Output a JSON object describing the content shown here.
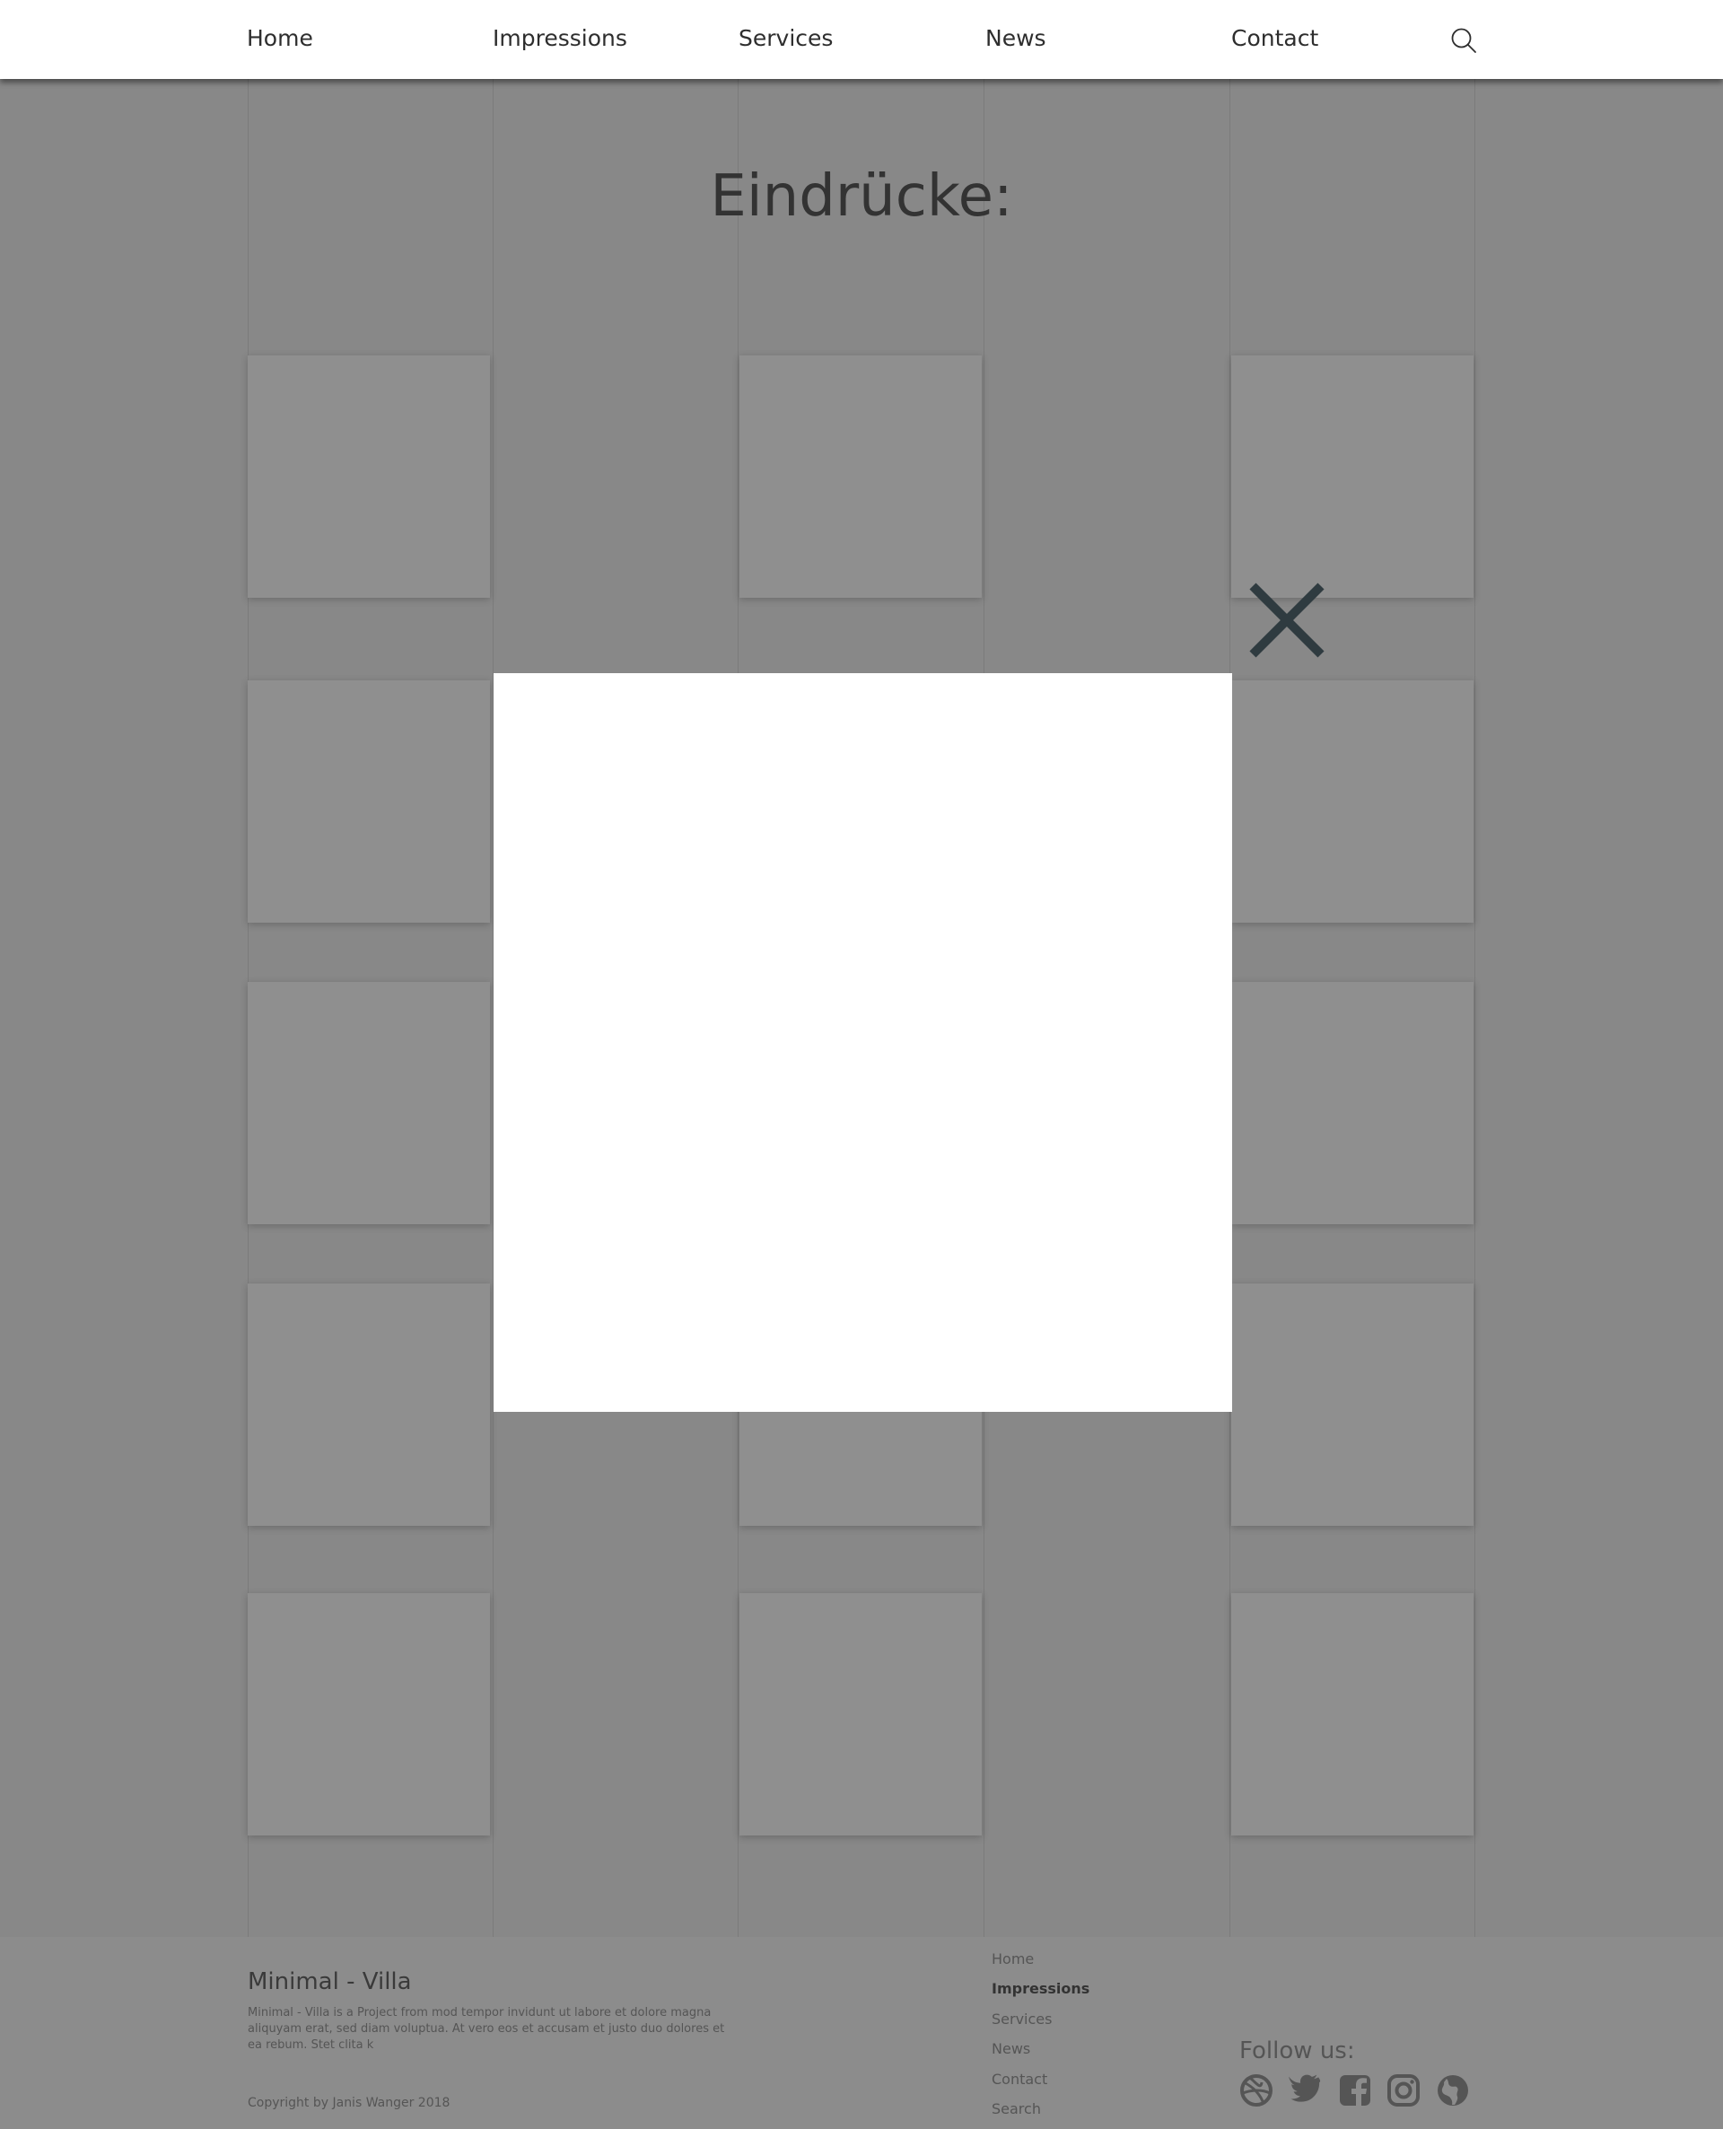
{
  "nav": {
    "items": [
      {
        "label": "Home"
      },
      {
        "label": "Impressions"
      },
      {
        "label": "Services"
      },
      {
        "label": "News"
      },
      {
        "label": "Contact"
      }
    ],
    "search_icon": "search-icon"
  },
  "main": {
    "heading": "Eindrücke:"
  },
  "modal": {
    "close_icon": "close-icon"
  },
  "footer": {
    "title": "Minimal - Villa",
    "description": "Minimal - Villa  is a Project from mod tempor invidunt ut labore et dolore magna aliquyam erat, sed diam voluptua. At vero eos et accusam et justo duo dolores et ea rebum. Stet clita k",
    "copyright": "Copyright by Janis Wanger 2018",
    "links": [
      {
        "label": "Home"
      },
      {
        "label": "Impressions"
      },
      {
        "label": "Services"
      },
      {
        "label": "News"
      },
      {
        "label": "Contact"
      },
      {
        "label": "Search"
      }
    ],
    "follow_label": "Follow us:",
    "social_icons": [
      "dribbble-icon",
      "twitter-icon",
      "facebook-icon",
      "instagram-icon",
      "globe-icon"
    ]
  },
  "colors": {
    "overlay_background": "#888888",
    "nav_background": "#ffffff",
    "text_dark": "#333333",
    "close_icon": "#2f3b40"
  }
}
